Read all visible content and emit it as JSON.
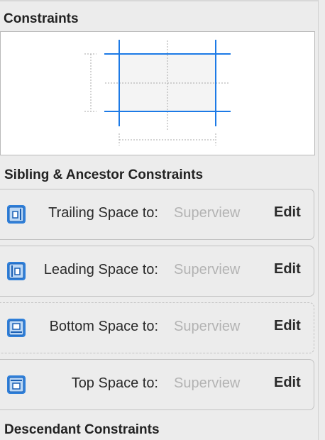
{
  "header": {
    "title": "Constraints"
  },
  "sibling_section": {
    "title": "Sibling & Ancestor Constraints"
  },
  "constraints": [
    {
      "label": "Trailing Space to:",
      "value": "Superview",
      "edit": "Edit",
      "icon": "trailing-space-icon"
    },
    {
      "label": "Leading Space to:",
      "value": "Superview",
      "edit": "Edit",
      "icon": "leading-space-icon"
    },
    {
      "label": "Bottom Space to:",
      "value": "Superview",
      "edit": "Edit",
      "icon": "bottom-space-icon"
    },
    {
      "label": "Top Space to:",
      "value": "Superview",
      "edit": "Edit",
      "icon": "top-space-icon"
    }
  ],
  "descendant_section": {
    "title": "Descendant Constraints"
  },
  "colors": {
    "accent": "#1c7ae6",
    "panel": "#ececec",
    "muted_text": "#b3b3b3"
  }
}
